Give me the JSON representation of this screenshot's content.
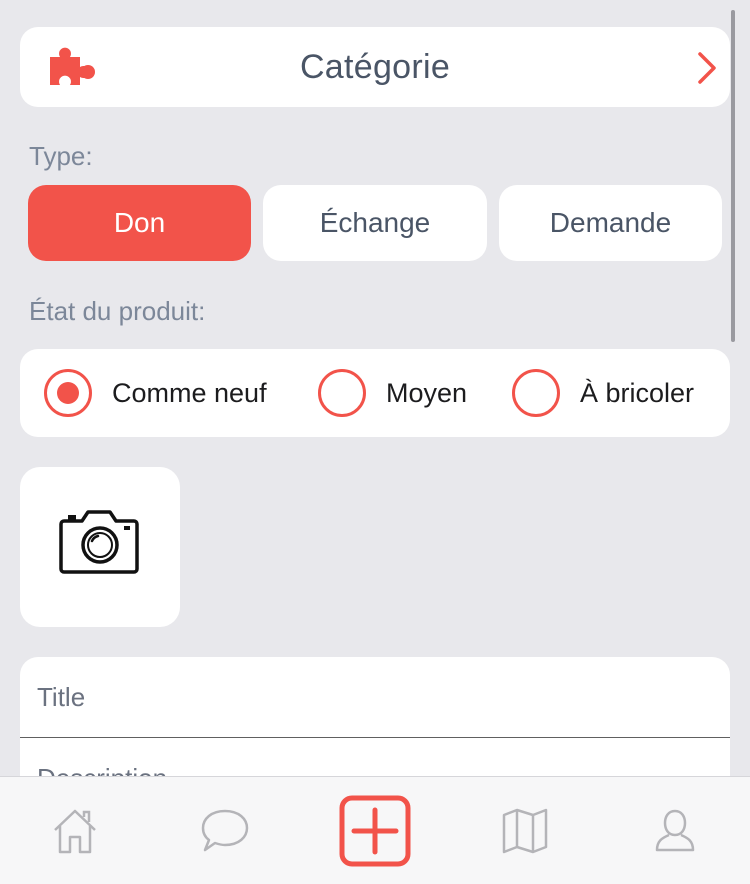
{
  "category": {
    "title": "Catégorie",
    "icon": "puzzle-icon",
    "chevron": "chevron-right-icon"
  },
  "type_section": {
    "label": "Type:",
    "options": [
      {
        "label": "Don",
        "selected": true
      },
      {
        "label": "Échange",
        "selected": false
      },
      {
        "label": "Demande",
        "selected": false
      }
    ]
  },
  "condition_section": {
    "label": "État du produit:",
    "options": [
      {
        "label": "Comme neuf",
        "selected": true
      },
      {
        "label": "Moyen",
        "selected": false
      },
      {
        "label": "À bricoler",
        "selected": false
      }
    ]
  },
  "photo": {
    "icon": "camera-icon"
  },
  "form": {
    "title_placeholder": "Title",
    "description_placeholder": "Description"
  },
  "tabbar": {
    "items": [
      {
        "icon": "home-icon"
      },
      {
        "icon": "chat-icon"
      },
      {
        "icon": "add-icon",
        "active": true
      },
      {
        "icon": "map-icon"
      },
      {
        "icon": "profile-icon"
      }
    ]
  },
  "colors": {
    "accent": "#f2534a",
    "background": "#e8e8ec",
    "card": "#ffffff",
    "text_muted": "#7c8799"
  }
}
